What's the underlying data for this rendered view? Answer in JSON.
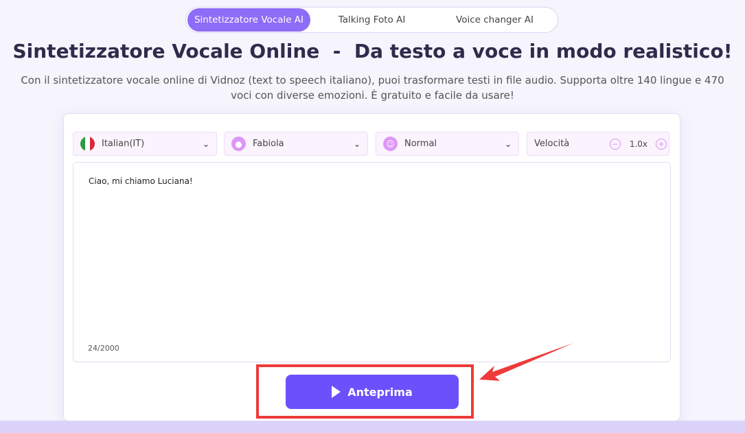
{
  "tabs": [
    {
      "label": "Sintetizzatore Vocale AI",
      "active": true
    },
    {
      "label": "Talking Foto AI"
    },
    {
      "label": "Voice changer AI"
    }
  ],
  "title": "Sintetizzatore Vocale Online  -  Da testo a voce in modo realistico!",
  "subtitle": "Con il sintetizzatore vocale online di Vidnoz (text to speech italiano), puoi trasformare testi in file audio. Supporta oltre 140 lingue e 470 voci con diverse emozioni. È gratuito e facile da usare!",
  "controls": {
    "language": "Italian(IT)",
    "voice": "Fabiola",
    "emotion": "Normal",
    "speed_label": "Velocità",
    "speed_value": "1.0x"
  },
  "text_input": {
    "value": "Ciao, mi chiamo Luciana!",
    "counter": "24/2000"
  },
  "preview_button": "Anteprima",
  "colors": {
    "accent": "#6b50fb",
    "tab_active": "#8d6cf7",
    "highlight": "#ee3a3a"
  }
}
